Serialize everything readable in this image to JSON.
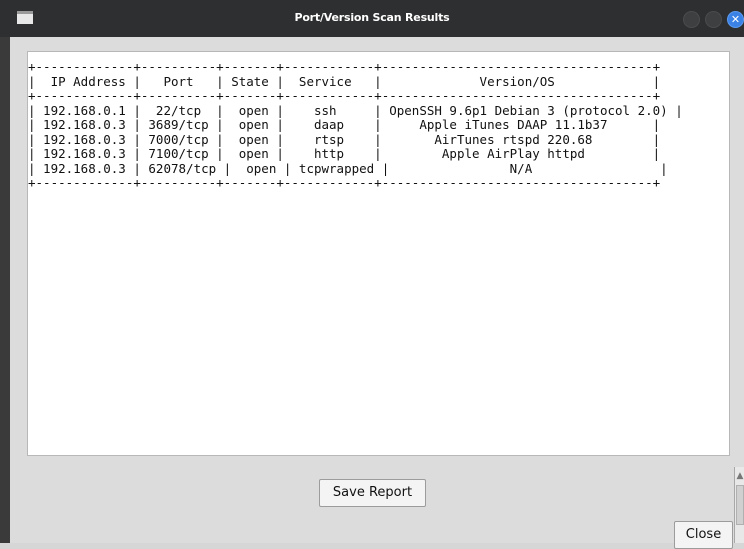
{
  "window": {
    "title": "Port/Version Scan Results",
    "close_glyph": "✕"
  },
  "report": {
    "text": "+-------------+----------+-------+------------+------------------------------------+\n|  IP Address |   Port   | State |  Service   |             Version/OS             |\n+-------------+----------+-------+------------+------------------------------------+\n| 192.168.0.1 |  22/tcp  |  open |    ssh     | OpenSSH 9.6p1 Debian 3 (protocol 2.0) |\n| 192.168.0.3 | 3689/tcp |  open |    daap    |     Apple iTunes DAAP 11.1b37      |\n| 192.168.0.3 | 7000/tcp |  open |    rtsp    |       AirTunes rtspd 220.68        |\n| 192.168.0.3 | 7100/tcp |  open |    http    |        Apple AirPlay httpd         |\n| 192.168.0.3 | 62078/tcp |  open | tcpwrapped |                N/A                 |\n+-------------+----------+-------+------------+------------------------------------+"
  },
  "buttons": {
    "save_label": "Save Report",
    "close_label": "Close"
  },
  "scrollbar": {
    "up_glyph": "▲"
  }
}
